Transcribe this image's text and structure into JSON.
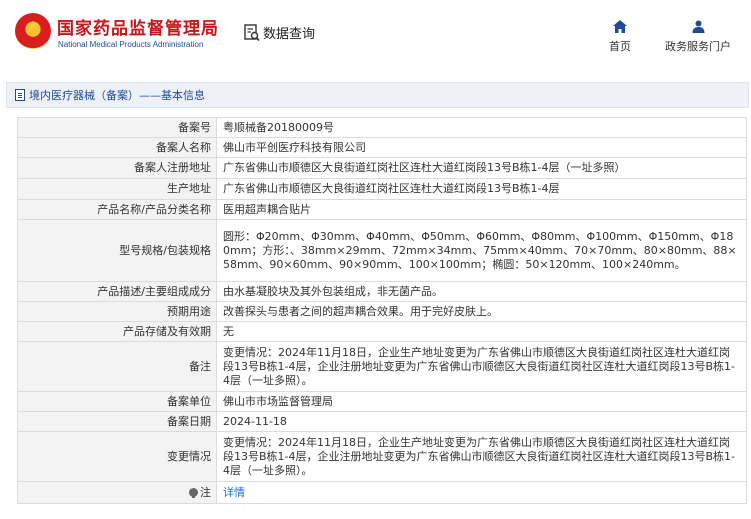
{
  "header": {
    "site_title": "国家药品监督管理局",
    "site_subtitle": "National Medical Products Administration",
    "db_query": "数据查询",
    "nav": [
      {
        "label": "首页",
        "icon": "home-icon"
      },
      {
        "label": "政务服务门户",
        "icon": "user-icon"
      }
    ]
  },
  "breadcrumb": {
    "text": "境内医疗器械（备案）——基本信息"
  },
  "rows": [
    {
      "label": "备案号",
      "value": "粤顺械备20180009号"
    },
    {
      "label": "备案人名称",
      "value": "佛山市平创医疗科技有限公司"
    },
    {
      "label": "备案人注册地址",
      "value": "广东省佛山市顺德区大良街道红岗社区连杜大道红岗段13号B栋1-4层（一址多照）"
    },
    {
      "label": "生产地址",
      "value": "广东省佛山市顺德区大良街道红岗社区连杜大道红岗段13号B栋1-4层"
    },
    {
      "label": "产品名称/产品分类名称",
      "value": "医用超声耦合贴片"
    },
    {
      "label": "型号规格/包装规格",
      "value": "圆形：Φ20mm、Φ30mm、Φ40mm、Φ50mm、Φ60mm、Φ80mm、Φ100mm、Φ150mm、Φ180mm；方形：、38mm×29mm、72mm×34mm、75mm×40mm、70×70mm、80×80mm、88×58mm、90×60mm、90×90mm、100×100mm；椭圆：50×120mm、100×240mm。"
    },
    {
      "label": "产品描述/主要组成成分",
      "value": "由水基凝胶块及其外包装组成，非无菌产品。"
    },
    {
      "label": "预期用途",
      "value": "改善探头与患者之间的超声耦合效果。用于完好皮肤上。"
    },
    {
      "label": "产品存储及有效期",
      "value": "无"
    },
    {
      "label": "备注",
      "value": "变更情况：2024年11月18日，企业生产地址变更为广东省佛山市顺德区大良街道红岗社区连杜大道红岗段13号B栋1-4层，企业注册地址变更为广东省佛山市顺德区大良街道红岗社区连杜大道红岗段13号B栋1-4层（一址多照）。"
    },
    {
      "label": "备案单位",
      "value": "佛山市市场监督管理局"
    },
    {
      "label": "备案日期",
      "value": "2024-11-18"
    },
    {
      "label": "变更情况",
      "value": "变更情况：2024年11月18日，企业生产地址变更为广东省佛山市顺德区大良街道红岗社区连杜大道红岗段13号B栋1-4层，企业注册地址变更为广东省佛山市顺德区大良街道红岗社区连杜大道红岗段13号B栋1-4层（一址多照）。"
    }
  ],
  "note_row": {
    "label": "注",
    "icon": "note-icon",
    "link": "详情"
  },
  "colors": {
    "brand_red": "#c8161d",
    "brand_blue": "#1e4a9a",
    "link": "#1e6fd9"
  }
}
